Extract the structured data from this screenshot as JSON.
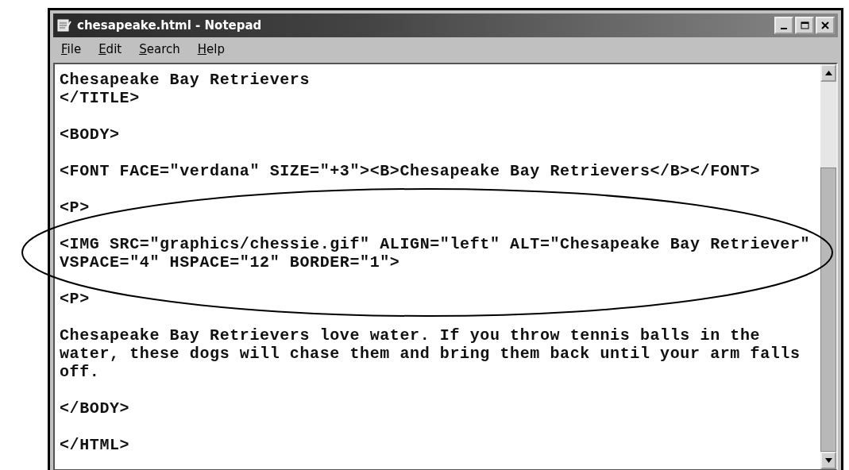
{
  "window": {
    "title": "chesapeake.html - Notepad"
  },
  "menu": [
    "File",
    "Edit",
    "Search",
    "Help"
  ],
  "editor": {
    "blocks": [
      [
        "Chesapeake Bay Retrievers",
        "</TITLE>"
      ],
      [
        "<BODY>"
      ],
      [
        "<FONT FACE=\"verdana\" SIZE=\"+3\"><B>Chesapeake Bay Retrievers</B></FONT>"
      ],
      [
        "<P>"
      ],
      [
        "<IMG SRC=\"graphics/chessie.gif\" ALIGN=\"left\" ALT=\"Chesapeake Bay Retriever\"",
        "VSPACE=\"4\" HSPACE=\"12\" BORDER=\"1\">"
      ],
      [
        "<P>"
      ],
      [
        "Chesapeake Bay Retrievers love water. If you throw tennis balls in the",
        "water, these dogs will chase them and bring them back until your arm falls",
        "off."
      ],
      [
        "</BODY>"
      ],
      [
        "</HTML>"
      ]
    ]
  }
}
